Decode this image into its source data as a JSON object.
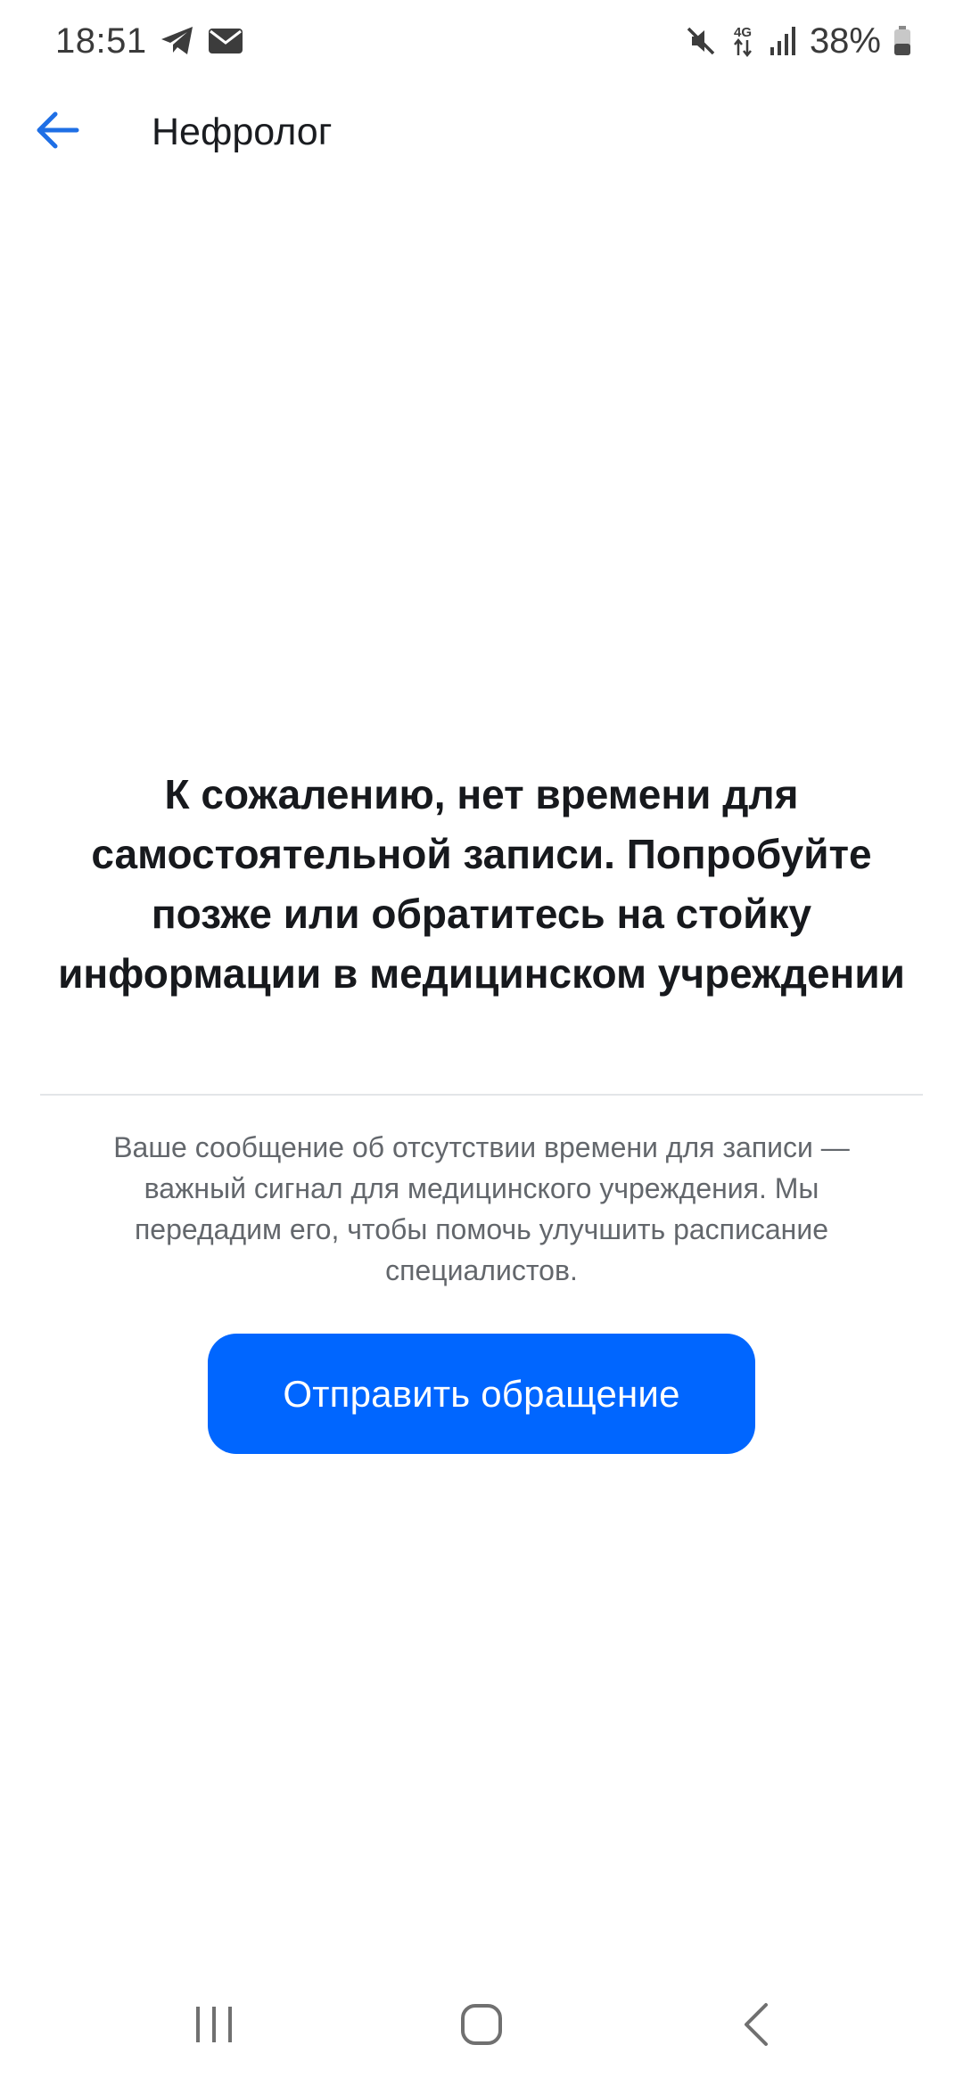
{
  "status_bar": {
    "time": "18:51",
    "battery": "38%",
    "left_icons": [
      "telegram-icon",
      "mail-icon"
    ],
    "right_icons": [
      "mute-icon",
      "network-4g-icon",
      "signal-icon",
      "battery-icon"
    ]
  },
  "app_bar": {
    "back_icon": "arrow-left-icon",
    "title": "Нефролог"
  },
  "message": {
    "title": "К сожалению, нет времени для самостоятельной записи. Попробуйте позже или обратитесь на стойку информации в медицинском учреждении",
    "note": "Ваше сообщение об отсутствии времени для записи — важный сигнал для медицинского учреждения. Мы передадим его, чтобы помочь улучшить расписание специалистов."
  },
  "actions": {
    "submit_label": "Отправить обращение"
  },
  "nav_bar": {
    "icons": [
      "recent-apps-icon",
      "home-icon",
      "back-icon"
    ]
  },
  "colors": {
    "accent": "#0066ff",
    "back_arrow": "#1f6fe5",
    "title_text": "#17191d",
    "note_text": "#63676c",
    "divider": "#e3e5e8"
  }
}
